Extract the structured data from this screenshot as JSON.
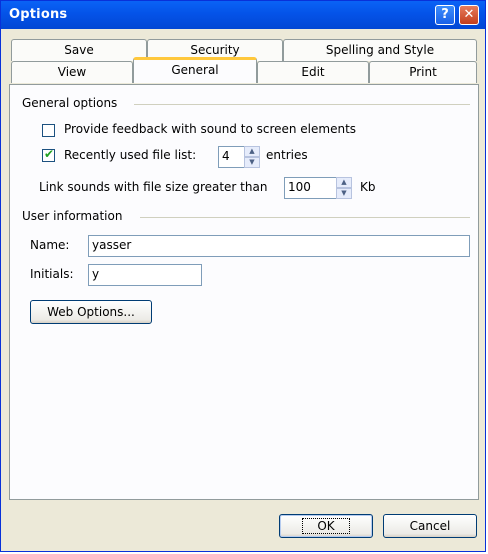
{
  "window": {
    "title": "Options"
  },
  "titlebar": {
    "help_glyph": "?",
    "close_glyph": "✕"
  },
  "tabs_back_row": [
    "Save",
    "Security",
    "Spelling and Style"
  ],
  "tabs_front_row": [
    "View",
    "General",
    "Edit",
    "Print"
  ],
  "active_tab": "General",
  "general_options": {
    "heading": "General options",
    "feedback_sound": {
      "label": "Provide feedback with sound to screen elements",
      "checked": false
    },
    "recent_files": {
      "label": "Recently used file list:",
      "checked": true,
      "value": "4",
      "suffix": "entries"
    },
    "link_sounds": {
      "label": "Link sounds with file size greater than",
      "value": "100",
      "suffix": "Kb"
    }
  },
  "user_information": {
    "heading": "User information",
    "name_label": "Name:",
    "name_value": "yasser",
    "initials_label": "Initials:",
    "initials_value": "y"
  },
  "web_options_label": "Web Options...",
  "footer": {
    "ok_label": "OK",
    "cancel_label": "Cancel"
  },
  "colors": {
    "titlebar": "#0453e8",
    "dialog_bg": "#ece9d8",
    "panel_bg": "#fcfcfe",
    "active_tab_accent": "#ffc83c"
  }
}
